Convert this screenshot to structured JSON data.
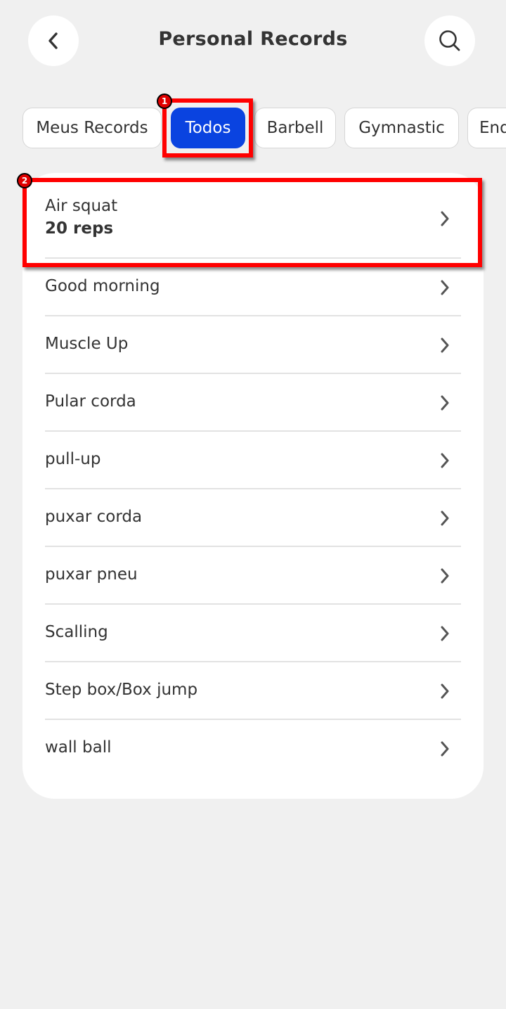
{
  "header": {
    "title": "Personal Records",
    "back_icon": "chevron-left-icon",
    "search_icon": "search-icon"
  },
  "filters": {
    "chips": [
      "Meus Records",
      "Todos",
      "Barbell",
      "Gymnastic",
      "End"
    ],
    "selected": "Todos"
  },
  "records": [
    {
      "name": "Air squat",
      "value": "20 reps"
    },
    {
      "name": "Good morning"
    },
    {
      "name": "Muscle Up"
    },
    {
      "name": "Pular corda"
    },
    {
      "name": "pull-up"
    },
    {
      "name": "puxar corda"
    },
    {
      "name": "puxar pneu"
    },
    {
      "name": "Scalling"
    },
    {
      "name": "Step box/Box jump"
    },
    {
      "name": "wall ball"
    }
  ],
  "annotations": [
    {
      "label": "1"
    },
    {
      "label": "2"
    }
  ],
  "colors": {
    "accent": "#0a43e0",
    "background": "#f0f0f0",
    "annotation": "#ff0000"
  }
}
